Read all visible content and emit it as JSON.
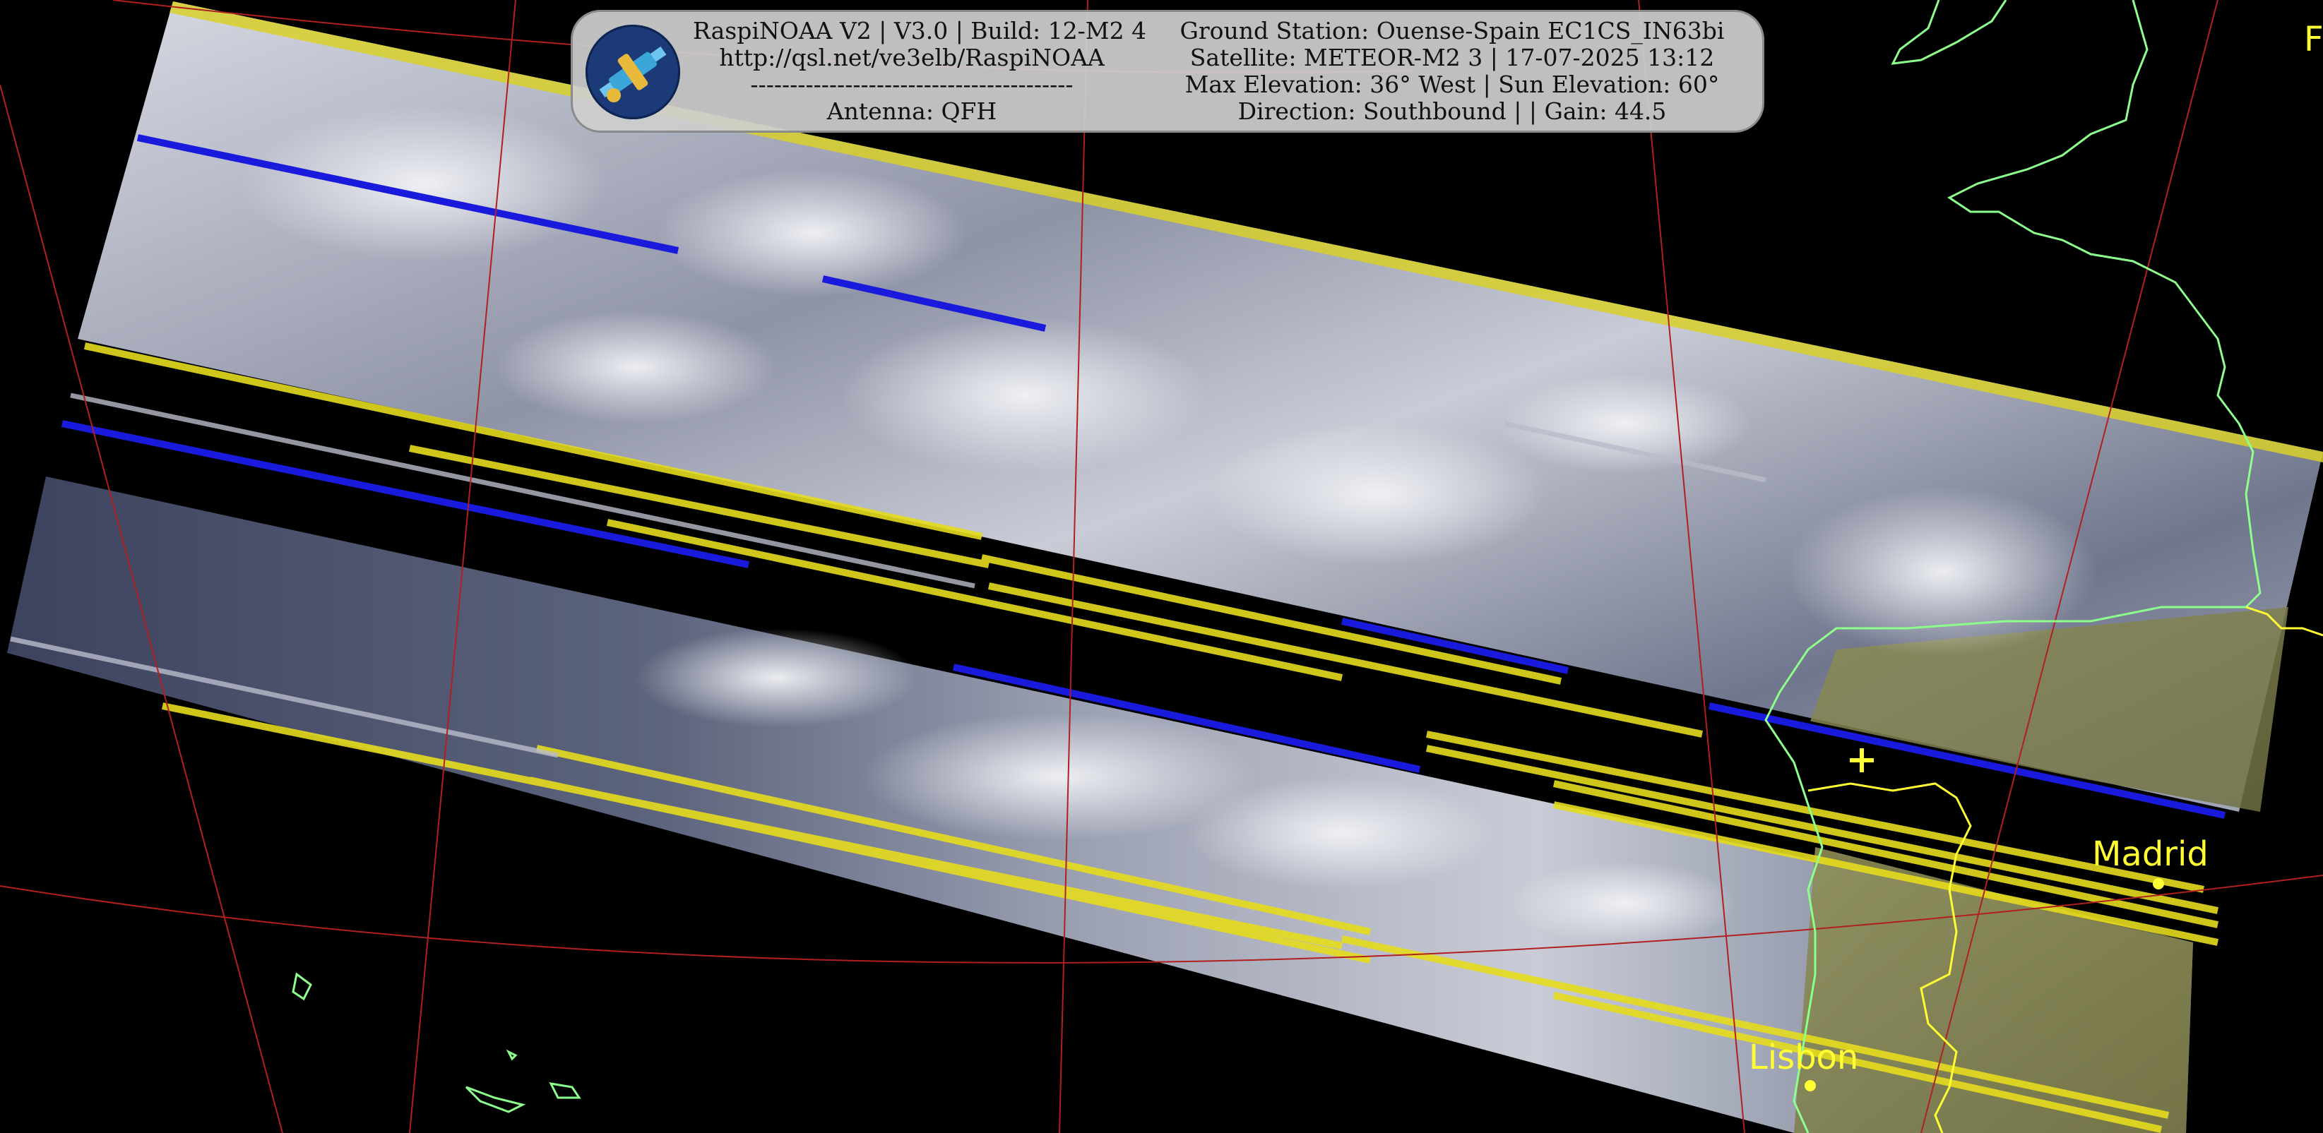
{
  "header": {
    "left_lines": [
      "RaspiNOAA V2 | V3.0 | Build: 12-M2 4",
      "http://qsl.net/ve3elb/RaspiNOAA",
      "-----------------------------------------",
      "Antenna: QFH"
    ],
    "right_lines": [
      "Ground Station: Ouense-Spain EC1CS_IN63bi",
      "Satellite: METEOR-M2 3 | 17-07-2025 13:12",
      "Max Elevation: 36° West | Sun Elevation: 60°",
      "Direction: Southbound | | Gain: 44.5"
    ]
  },
  "map": {
    "cities": [
      {
        "name": "Madrid"
      },
      {
        "name": "Lisbon"
      }
    ],
    "edge_letter": "F",
    "colors": {
      "grid_lines": "#b02020",
      "coastline": "#8cff8c",
      "border": "#ffff33",
      "city": "#ffff33",
      "scan_gap_blue": "#1a1adc",
      "scan_gap_yellow": "#e6dc1e"
    }
  }
}
